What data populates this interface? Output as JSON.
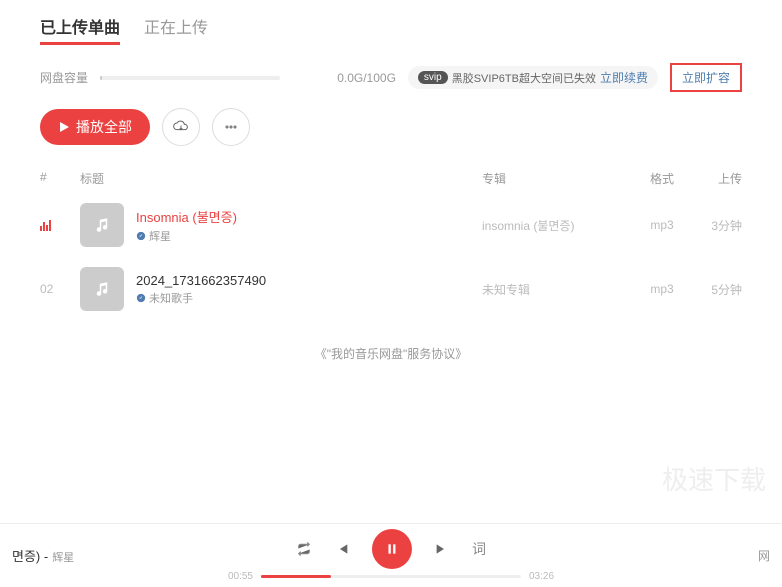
{
  "tabs": {
    "uploaded": "已上传单曲",
    "uploading": "正在上传"
  },
  "storage": {
    "label": "网盘容量",
    "text": "0.0G/100G",
    "badge_pill": "svip",
    "badge_text": "黑胶SVIP6TB超大空间已失效",
    "renew": "立即续费",
    "expand": "立即扩容"
  },
  "toolbar": {
    "play_all": "播放全部"
  },
  "columns": {
    "idx": "#",
    "title": "标题",
    "album": "专辑",
    "format": "格式",
    "time": "上传"
  },
  "tracks": [
    {
      "idx": "",
      "title": "Insomnia (불면증)",
      "artist": "辉星",
      "album": "insomnia (불면증)",
      "format": "mp3",
      "time": "3分钟",
      "playing": true
    },
    {
      "idx": "02",
      "title": "2024_1731662357490",
      "artist": "未知歌手",
      "album": "未知专辑",
      "format": "mp3",
      "time": "5分钟",
      "playing": false
    }
  ],
  "agreement": "《\"我的音乐网盘\"服务协议》",
  "watermark": "极速下载",
  "player": {
    "title_suffix": "면증) - ",
    "artist": "辉星",
    "current": "00:55",
    "duration": "03:26",
    "lyric": "词",
    "right": "网"
  }
}
